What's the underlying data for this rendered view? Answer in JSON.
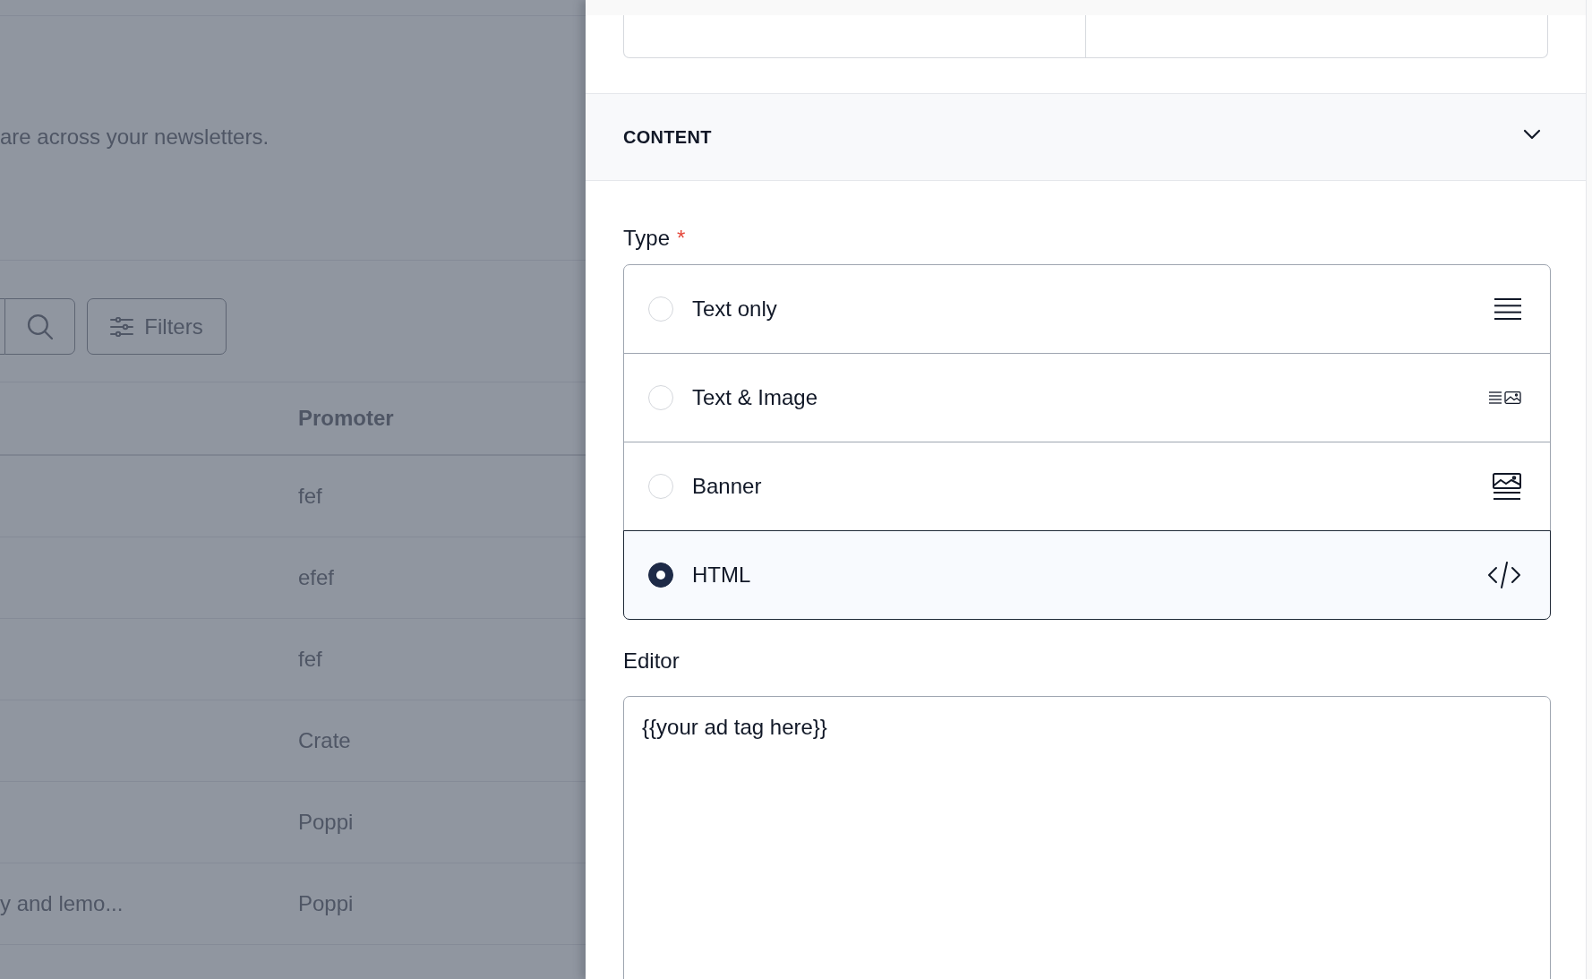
{
  "background_page": {
    "description": "are across your newsletters.",
    "filters_button": "Filters",
    "table": {
      "promoter_header": "Promoter",
      "rows": [
        {
          "promoter": "fef"
        },
        {
          "promoter": "efef"
        },
        {
          "promoter": "fef"
        },
        {
          "promoter": "Crate"
        },
        {
          "promoter": "Poppi"
        },
        {
          "column_1": "y and lemo...",
          "promoter": "Poppi"
        }
      ]
    }
  },
  "drawer": {
    "section": {
      "title": "CONTENT",
      "expanded": true
    },
    "type_field": {
      "label": "Type",
      "required_mark": "*",
      "options": [
        {
          "label": "Text only",
          "kind": "text",
          "selected": false
        },
        {
          "label": "Text & Image",
          "kind": "text_image",
          "selected": false
        },
        {
          "label": "Banner",
          "kind": "banner",
          "selected": false
        },
        {
          "label": "HTML",
          "kind": "html",
          "selected": true
        }
      ]
    },
    "editor": {
      "label": "Editor",
      "value": "{{your ad tag here}}"
    }
  }
}
